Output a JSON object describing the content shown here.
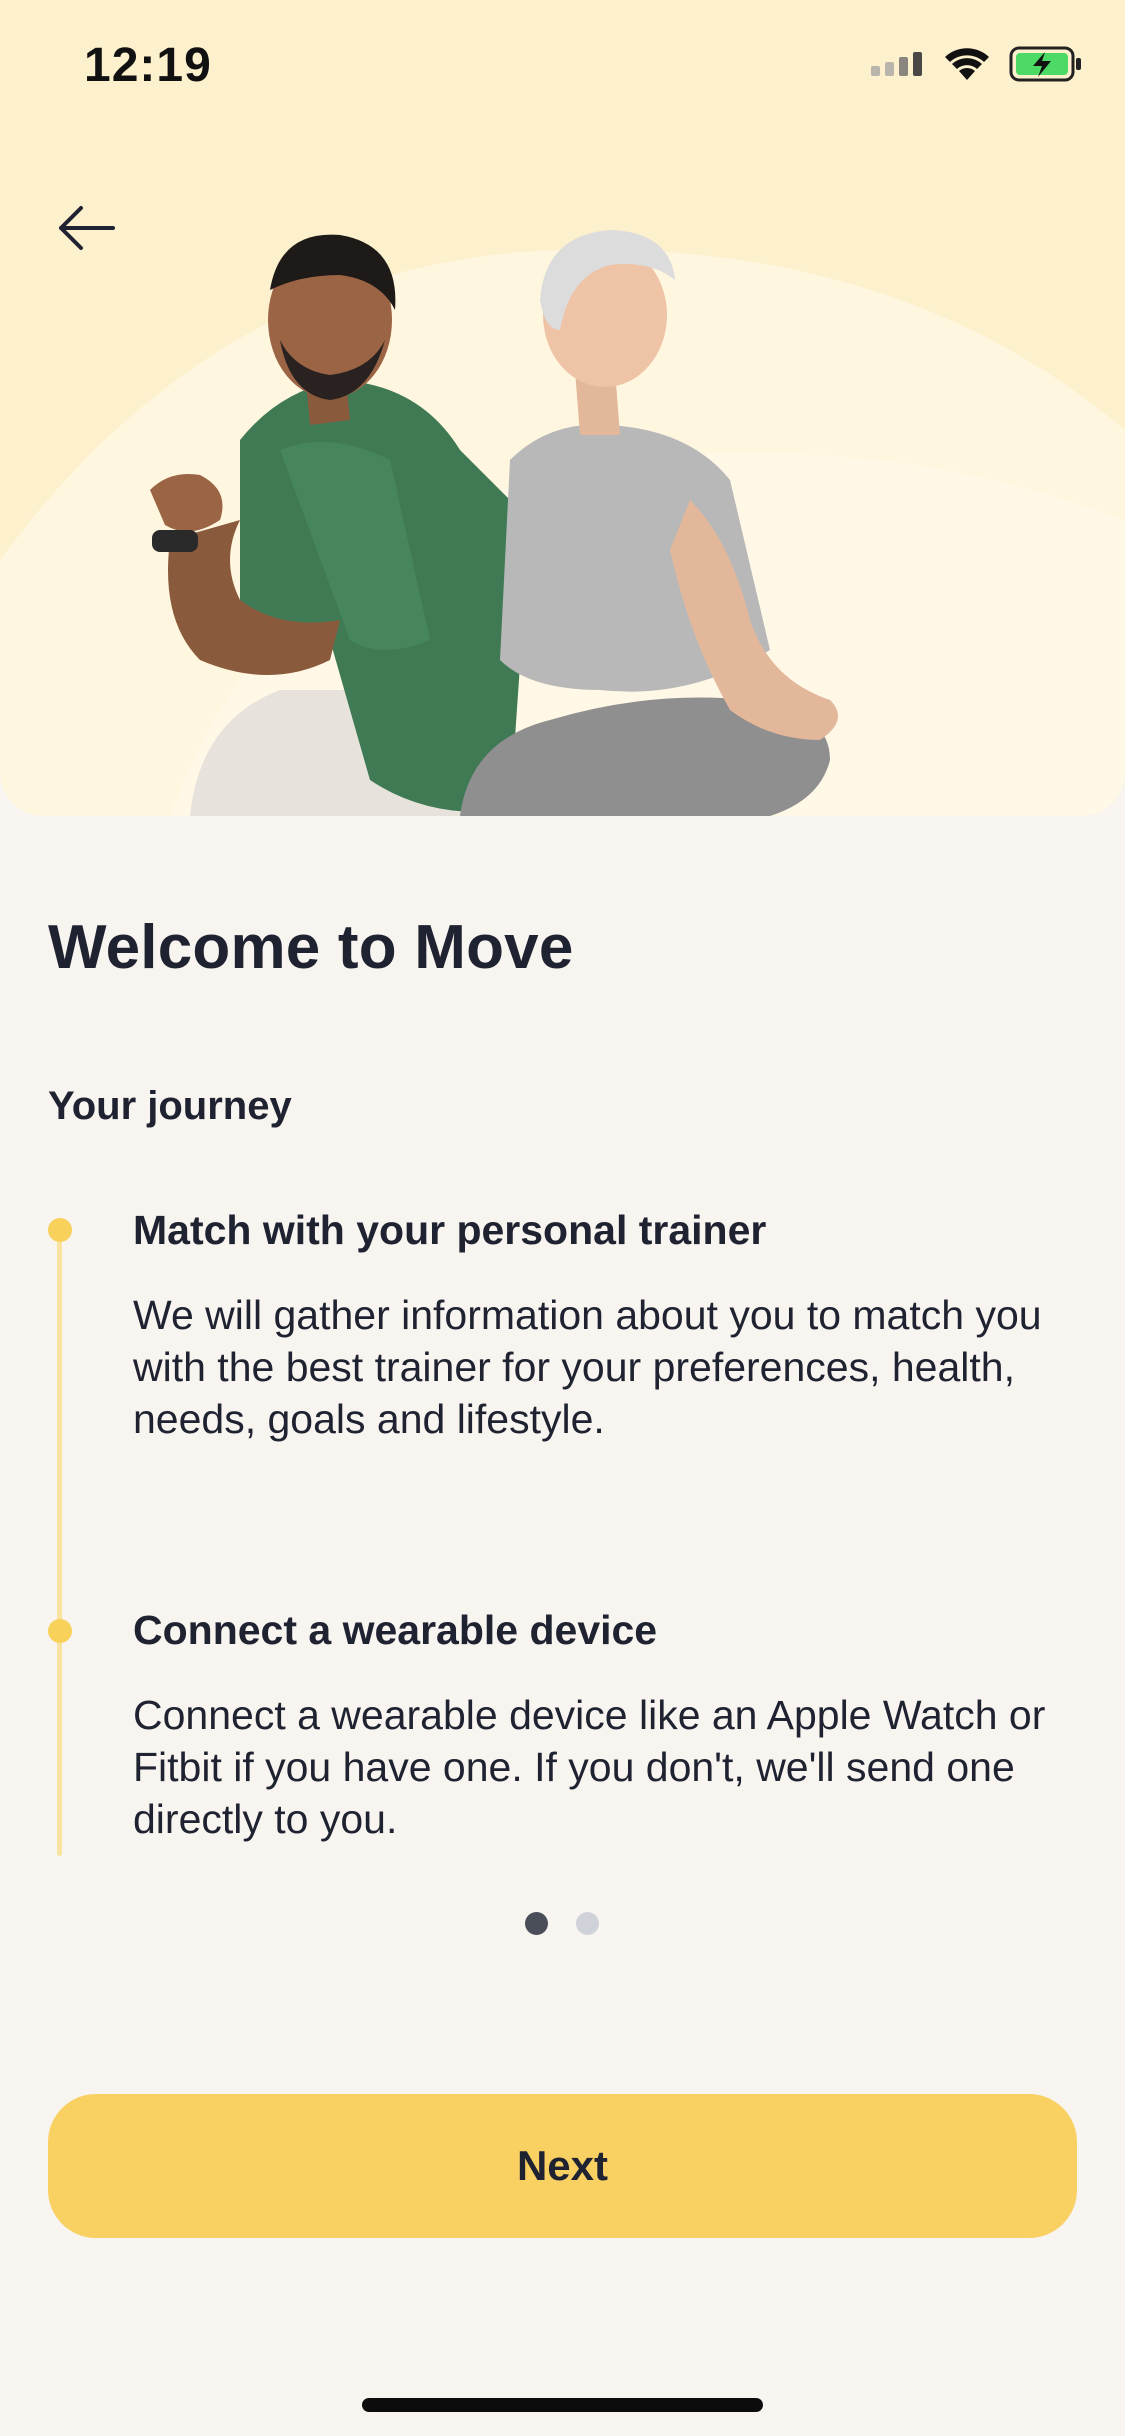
{
  "status_bar": {
    "time": "12:19",
    "icons": [
      "signal-icon",
      "wifi-icon",
      "battery-charging-icon"
    ],
    "battery_color": "#4cd964"
  },
  "header": {
    "back_icon": "arrow-left-icon"
  },
  "hero": {
    "image": "two-people-exercising-photo",
    "background": "#fdf0cc"
  },
  "welcome": {
    "title": "Welcome to Move",
    "subtitle": "Your journey"
  },
  "journey": {
    "steps": [
      {
        "title": "Match with your personal trainer",
        "text": "We will gather information about you to match you with the best trainer for your preferences, health, needs, goals and lifestyle."
      },
      {
        "title": "Connect a wearable device",
        "text": "Connect a wearable device like an Apple Watch or Fitbit if you have one. If you don't, we'll send one directly to you."
      }
    ],
    "accent": "#f7d15a"
  },
  "pager": {
    "current": 1,
    "total": 2
  },
  "actions": {
    "next_label": "Next",
    "button_color": "#f9d163"
  }
}
